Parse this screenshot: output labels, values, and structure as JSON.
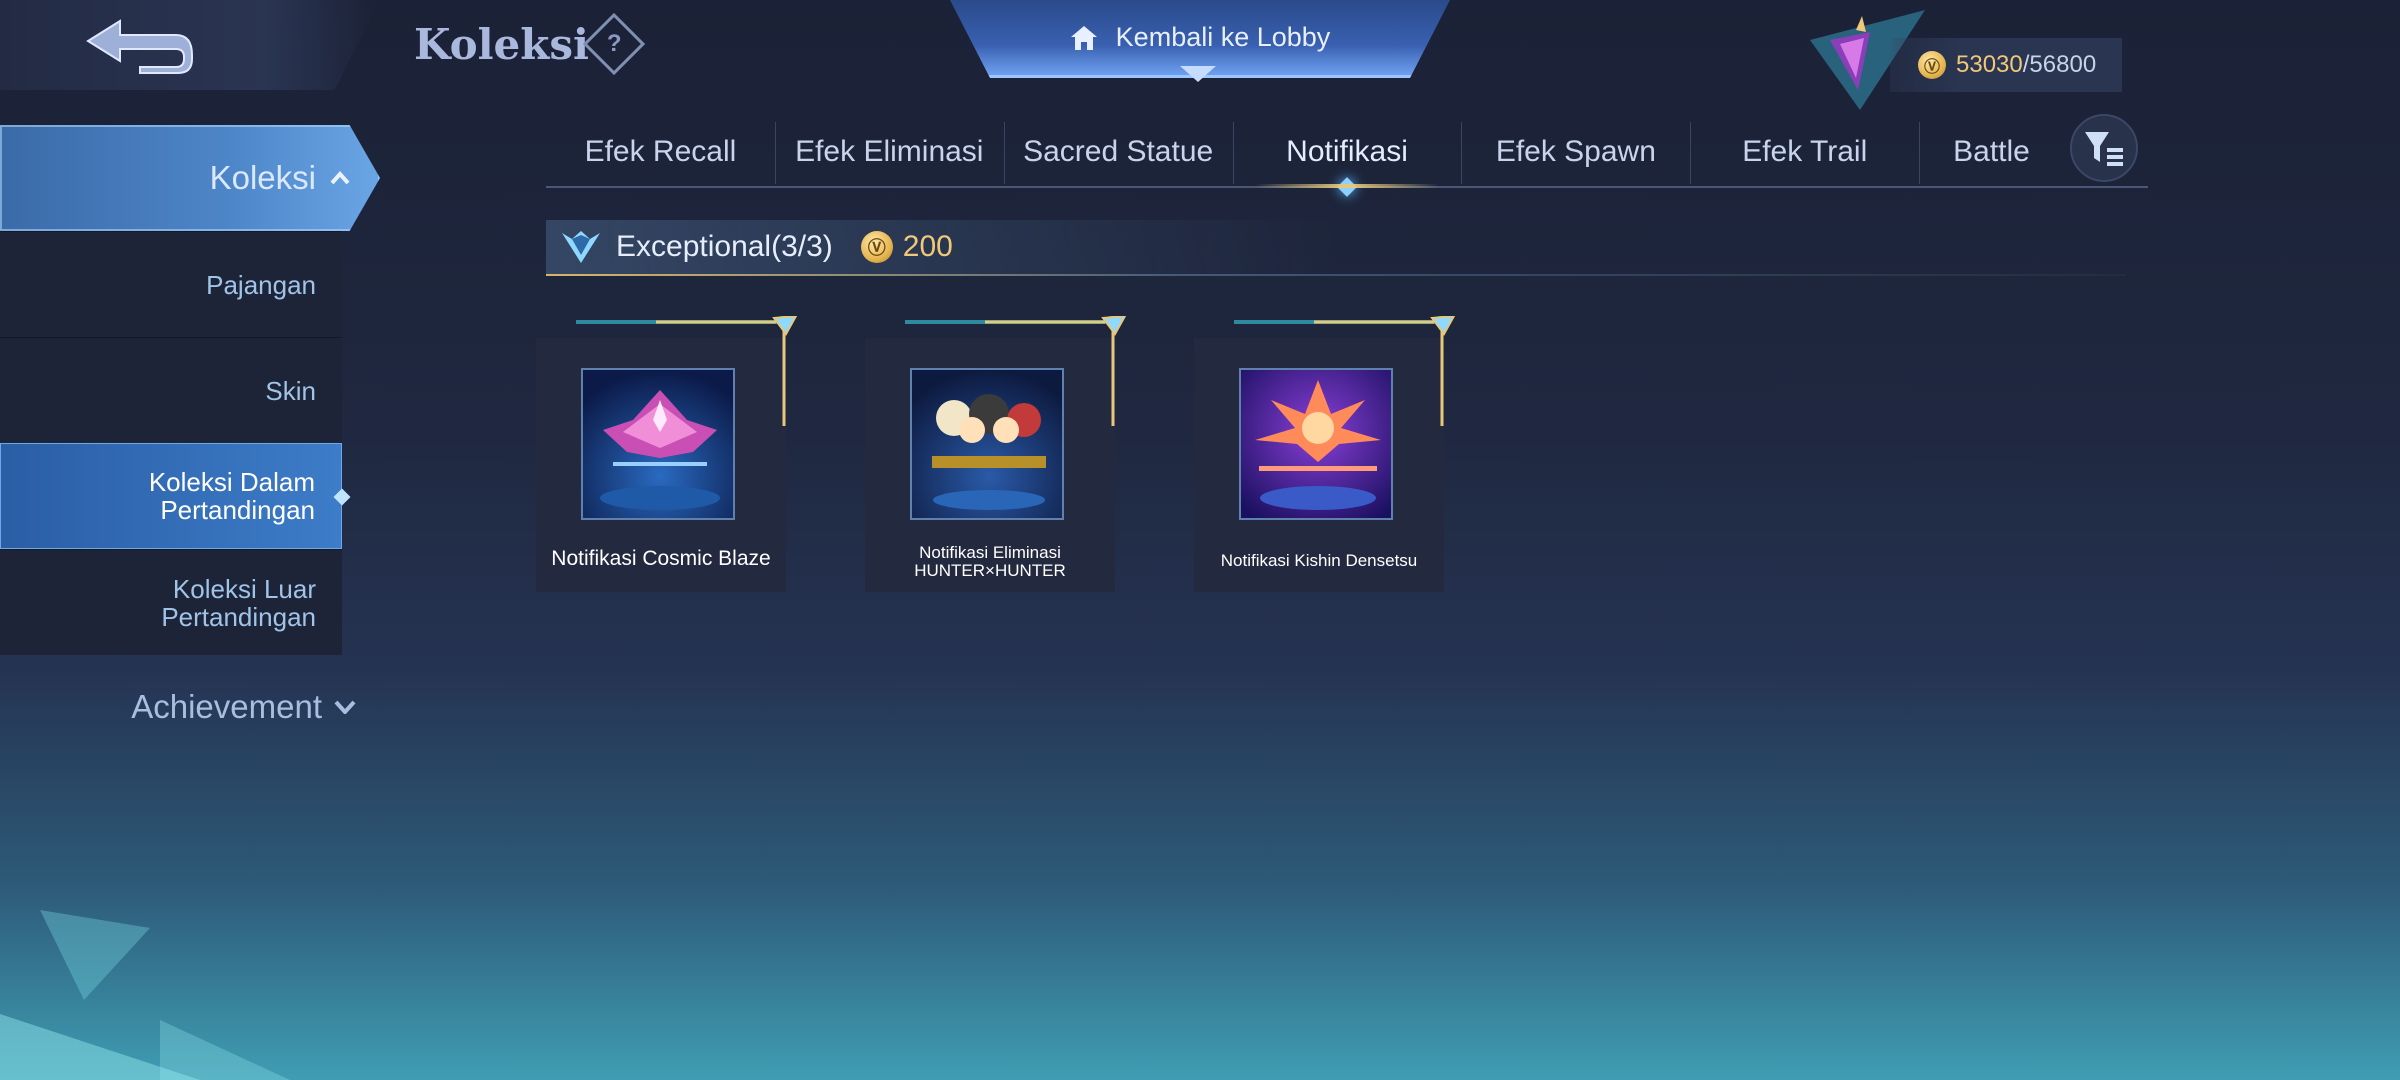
{
  "header": {
    "title": "Koleksi",
    "help_icon": "?",
    "lobby_label": "Kembali ke Lobby"
  },
  "points": {
    "current": "53030",
    "separator": "/",
    "max": "56800"
  },
  "sidebar": {
    "section_label": "Koleksi",
    "items": [
      {
        "label": "Pajangan"
      },
      {
        "label": "Skin"
      },
      {
        "label_line1": "Koleksi Dalam",
        "label_line2": "Pertandingan"
      },
      {
        "label_line1": "Koleksi Luar",
        "label_line2": "Pertandingan"
      }
    ],
    "active_index": 2,
    "achievement_label": "Achievement"
  },
  "tabs": [
    {
      "label": "Efek Recall"
    },
    {
      "label": "Efek Eliminasi"
    },
    {
      "label": "Sacred Statue"
    },
    {
      "label": "Notifikasi"
    },
    {
      "label": "Efek Spawn"
    },
    {
      "label": "Efek Trail"
    },
    {
      "label": "Battle"
    }
  ],
  "active_tab": "Notifikasi",
  "tier": {
    "label": "Exceptional",
    "count": "(3/3)",
    "cost": "200"
  },
  "cards": [
    {
      "name": "Notifikasi Cosmic Blaze"
    },
    {
      "name_line1": "Notifikasi Eliminasi",
      "name_line2": "HUNTER×HUNTER"
    },
    {
      "name": "Notifikasi Kishin Densetsu"
    }
  ],
  "colors": {
    "accent_gold": "#e8c878",
    "active_blue": "#3d7cc8",
    "points_gold": "#f0c878"
  }
}
